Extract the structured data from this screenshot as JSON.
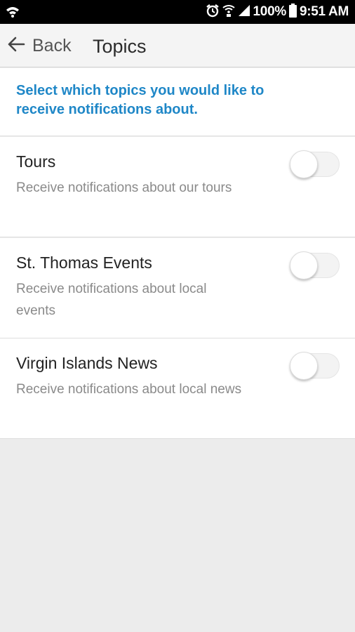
{
  "status_bar": {
    "battery_text": "100%",
    "time": "9:51 AM",
    "icons": [
      "wifi-icon",
      "alarm-icon",
      "wifi-calling-icon",
      "signal-icon",
      "battery-icon"
    ]
  },
  "app_bar": {
    "back_label": "Back",
    "title": "Topics"
  },
  "header": {
    "text": "Select which topics you would like to receive notifications about."
  },
  "topics": [
    {
      "title": "Tours",
      "description": "Receive notifications about our tours",
      "enabled": false
    },
    {
      "title": "St. Thomas Events",
      "description": "Receive notifications about local events",
      "enabled": false
    },
    {
      "title": "Virgin Islands News",
      "description": "Receive notifications about local news",
      "enabled": false
    }
  ],
  "colors": {
    "accent": "#1f87c7",
    "status_bar": "#000000",
    "app_bar": "#f4f4f4",
    "background": "#ececec"
  }
}
